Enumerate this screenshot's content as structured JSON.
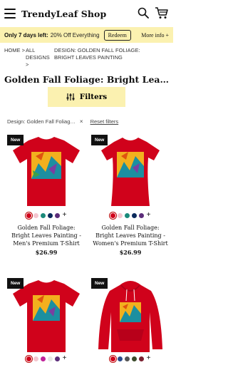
{
  "header": {
    "brand": "TrendyLeaf Shop",
    "icons": [
      "menu-icon",
      "search-icon",
      "cart-icon"
    ]
  },
  "promo": {
    "lead": "Only 7 days left:",
    "offer": "20% Off Everything",
    "redeem_label": "Redeem",
    "more_label": "More info",
    "more_icon": "plus-icon",
    "background": "#fbf1b0"
  },
  "breadcrumb": {
    "home": "HOME",
    "designs": "ALL DESIGNS",
    "current": "DESIGN: GOLDEN FALL FOLIAGE: BRIGHT LEAVES PAINTING",
    "separator": ">"
  },
  "page_title": "Golden Fall Foliage: Bright Lea…",
  "filter": {
    "label": "Filters",
    "icon": "sliders-icon"
  },
  "active_filter": {
    "text": "Design: Golden Fall Foliag…",
    "remove": "×",
    "reset": "Reset filters"
  },
  "products": [
    {
      "badge": "New",
      "name": "Golden Fall Foliage: Bright Leaves Painting - Men's Premium T-Shirt",
      "price": "$26.99",
      "swatches": [
        "#d0021b",
        "#f4c6cf",
        "#1a8a7a",
        "#0b2a5c",
        "#5c2d7a"
      ],
      "more_colors": "+"
    },
    {
      "badge": "New",
      "name": "Golden Fall Foliage: Bright Leaves Painting - Women's Premium T-Shirt",
      "price": "$26.99",
      "swatches": [
        "#d0021b",
        "#f4c6cf",
        "#1a8a7a",
        "#0b2a5c",
        "#5c2d7a"
      ],
      "more_colors": "+"
    },
    {
      "badge": "New",
      "swatches": [
        "#d0021b",
        "#f4c6cf",
        "#c0229a",
        "#e6e6e6",
        "#5c2d7a"
      ],
      "more_colors": "+"
    },
    {
      "badge": "New",
      "swatches": [
        "#d0021b",
        "#2b4b8c",
        "#555555",
        "#3a4a2a",
        "#7a2030"
      ],
      "more_colors": "+"
    }
  ],
  "colors": {
    "accent": "#fbf1b0",
    "shirt_red": "#d0021b",
    "badge": "#111111"
  }
}
